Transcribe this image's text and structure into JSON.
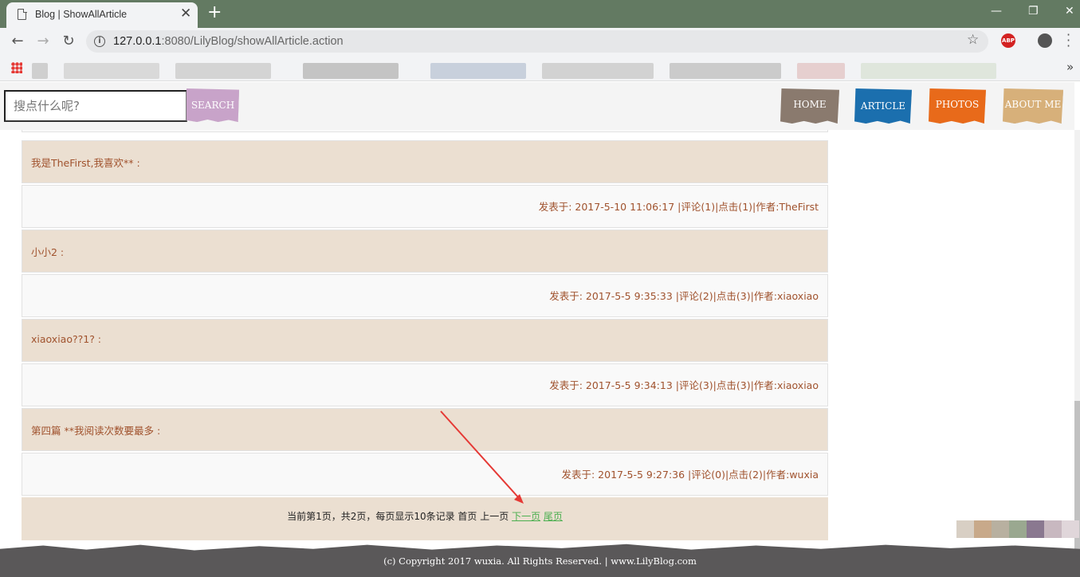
{
  "browser": {
    "tab_title": "Blog | ShowAllArticle",
    "url_host": "127.0.0.1",
    "url_rest": ":8080/LilyBlog/showAllArticle.action",
    "abp_label": "ABP"
  },
  "header": {
    "search_placeholder": "搜点什么呢?",
    "search_button": "SEARCH",
    "nav": [
      {
        "label": "HOME",
        "color": "#8a7a6e"
      },
      {
        "label": "ARTICLE",
        "color": "#1b6fae"
      },
      {
        "label": "PHOTOS",
        "color": "#e86a1a"
      },
      {
        "label": "ABOUT ME",
        "color": "#d7b07a"
      }
    ]
  },
  "articles": [
    {
      "title": "我是TheFirst,我喜欢** :",
      "meta": "发表于: 2017-5-10 11:06:17 |评论(1)|点击(1)|作者:TheFirst"
    },
    {
      "title": "小小2 :",
      "meta": "发表于: 2017-5-5 9:35:33 |评论(2)|点击(3)|作者:xiaoxiao"
    },
    {
      "title": "xiaoxiao??1? :",
      "meta": "发表于: 2017-5-5 9:34:13 |评论(3)|点击(3)|作者:xiaoxiao"
    },
    {
      "title": "第四篇 **我阅读次数要最多 :",
      "meta": "发表于: 2017-5-5 9:27:36 |评论(0)|点击(2)|作者:wuxia"
    }
  ],
  "pager": {
    "info": "当前第1页，共2页，每页显示10条记录 首页 上一页",
    "next": "下一页",
    "last": "尾页"
  },
  "footer": {
    "copyright": "(c) Copyright 2017 wuxia. All Rights Reserved. | www.LilyBlog.com"
  },
  "colors": {
    "title_row_bg": "#ebdfd1",
    "meta_row_bg": "#f9f9f9",
    "text_accent": "#a0522d",
    "link_green": "#4caf50",
    "annotation_arrow": "#e53935"
  }
}
